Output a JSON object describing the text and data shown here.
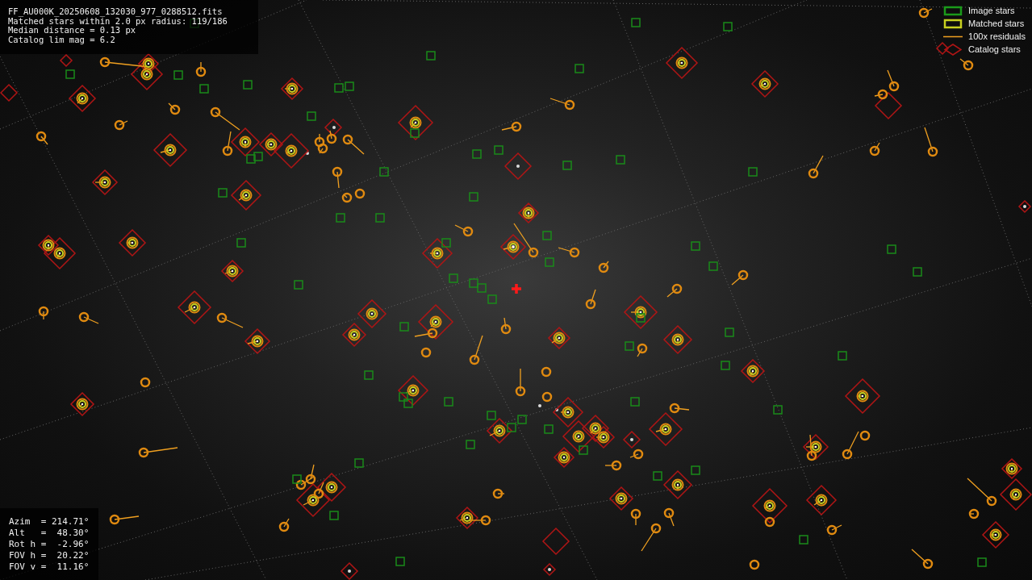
{
  "info_lines": [
    "FF_AU000K_20250608_132030_977_0288512.fits",
    "Matched stars within 2.0 px radius: 119/186",
    "Median distance = 0.13 px",
    "Catalog lim mag = 6.2"
  ],
  "legend": [
    {
      "kind": "image",
      "label": "Image stars"
    },
    {
      "kind": "matched",
      "label": "Matched stars"
    },
    {
      "kind": "residual",
      "label": "100x residuals"
    },
    {
      "kind": "catalog",
      "label": "Catalog stars"
    }
  ],
  "orientation_lines": [
    "Azim  = 214.71°",
    "Alt   =  48.30°",
    "Rot h =  -2.96°",
    "FOV h =  20.22°",
    "FOV v =  11.16°"
  ]
}
